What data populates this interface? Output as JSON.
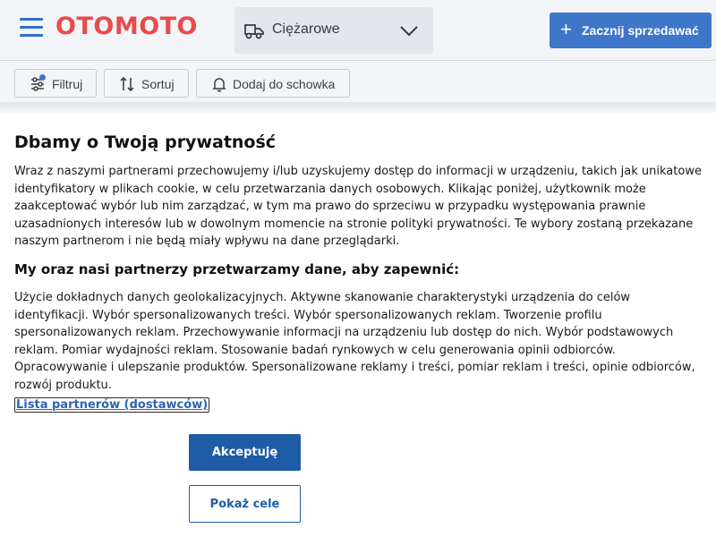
{
  "header": {
    "logo_text": "OTOMOTO",
    "category": {
      "label": "Ciężarowe",
      "icon": "truck-icon"
    },
    "sell_button_label": "Zacznij sprzedawać",
    "colors": {
      "logo": "#e84b4b",
      "accent": "#3e77c9"
    }
  },
  "toolbar": {
    "filter_label": "Filtruj",
    "sort_label": "Sortuj",
    "save_label": "Dodaj do schowka"
  },
  "consent": {
    "title": "Dbamy o Twoją prywatność",
    "body": "Wraz z naszymi partnerami przechowujemy i/lub uzyskujemy dostęp do informacji w urządzeniu, takich jak unikatowe identyfikatory w plikach cookie, w celu przetwarzania danych osobowych. Klikając poniżej, użytkownik może zaakceptować wybór lub nim zarządzać, w tym ma prawo do sprzeciwu w przypadku występowania prawnie uzasadnionych interesów lub w dowolnym momencie na stronie polityki prywatności. Te wybory zostaną przekazane naszym partnerom i nie będą miały wpływu na dane przeglądarki.",
    "subtitle": "My oraz nasi partnerzy przetwarzamy dane, aby zapewnić:",
    "purposes": "Użycie dokładnych danych geolokalizacyjnych. Aktywne skanowanie charakterystyki urządzenia do celów identyfikacji. Wybór spersonalizowanych treści. Wybór spersonalizowanych reklam. Tworzenie profilu spersonalizowanych reklam. Przechowywanie informacji na urządzeniu lub dostęp do nich. Wybór podstawowych reklam. Pomiar wydajności reklam. Stosowanie badań rynkowych w celu generowania opinii odbiorców. Opracowywanie i ulepszanie produktów. Spersonalizowane reklamy i treści, pomiar reklam i treści, opinie odbiorców, rozwój produktu.",
    "partners_link": "Lista partnerów (dostawców)",
    "accept_label": "Akceptuję",
    "purposes_button_label": "Pokaż cele",
    "colors": {
      "primary_button": "#1e5ca5",
      "link": "#2c64b0"
    }
  }
}
